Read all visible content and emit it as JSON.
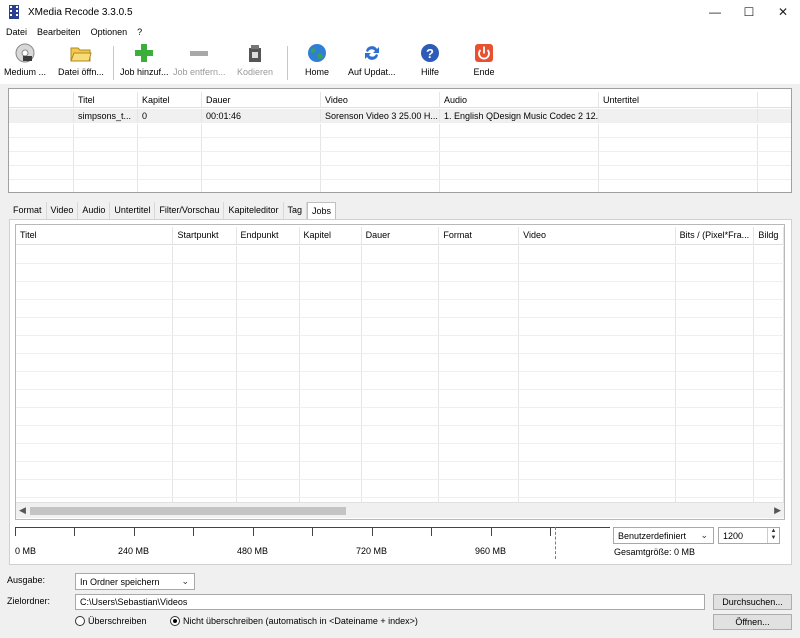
{
  "window": {
    "title": "XMedia Recode 3.3.0.5"
  },
  "menu": [
    "Datei",
    "Bearbeiten",
    "Optionen",
    "?"
  ],
  "toolbar": {
    "medium": "Medium ...",
    "datei_oeffnen": "Datei öffn...",
    "job_hinzufuegen": "Job hinzuf...",
    "job_entfernen": "Job entfern...",
    "kodieren": "Kodieren",
    "home": "Home",
    "update": "Auf Updat...",
    "hilfe": "Hilfe",
    "ende": "Ende"
  },
  "files_table": {
    "headers": [
      "Titel",
      "Kapitel",
      "Dauer",
      "Video",
      "Audio",
      "Untertitel"
    ],
    "rows": [
      [
        "simpsons_t...",
        "0",
        "00:01:46",
        "Sorenson Video 3 25.00 H...",
        "1. English QDesign Music Codec 2 12...",
        ""
      ]
    ]
  },
  "tabs": [
    "Format",
    "Video",
    "Audio",
    "Untertitel",
    "Filter/Vorschau",
    "Kapiteleditor",
    "Tag",
    "Jobs"
  ],
  "active_tab": "Jobs",
  "jobs_table": {
    "headers": [
      "Titel",
      "Startpunkt",
      "Endpunkt",
      "Kapitel",
      "Dauer",
      "Format",
      "Video",
      "Bits / (Pixel*Fra...",
      "Bildg"
    ]
  },
  "size_ruler": {
    "labels": [
      "0 MB",
      "240 MB",
      "480 MB",
      "720 MB",
      "960 MB"
    ]
  },
  "size_preset": "Benutzerdefiniert",
  "size_value": "1200",
  "total_size": "Gesamtgröße: 0 MB",
  "output": {
    "label": "Ausgabe:",
    "value": "In Ordner speichern"
  },
  "target": {
    "label": "Zielordner:",
    "value": "C:\\Users\\Sebastian\\Videos",
    "browse": "Durchsuchen...",
    "open": "Öffnen..."
  },
  "overwrite": {
    "option1": "Überschreiben",
    "option2": "Nicht überschreiben (automatisch in <Dateiname + index>)",
    "selected": "option2"
  }
}
